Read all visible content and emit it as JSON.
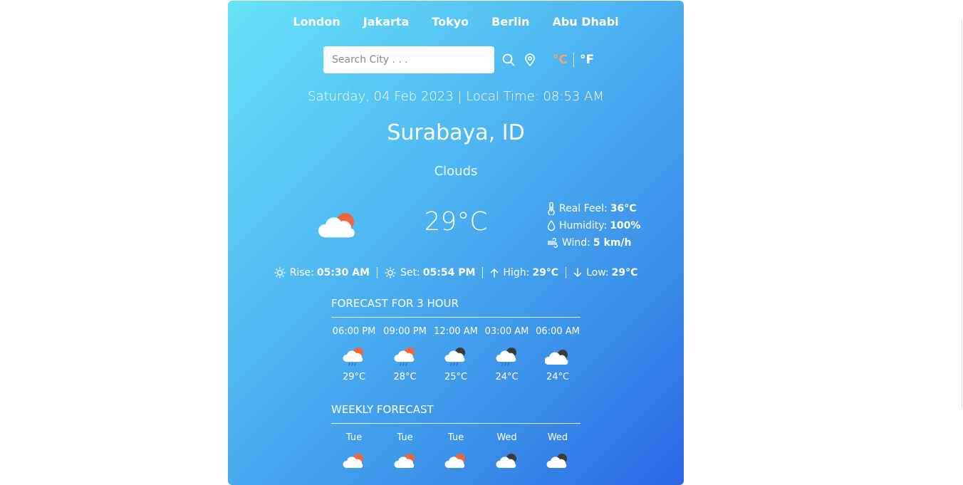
{
  "cities": [
    "London",
    "Jakarta",
    "Tokyo",
    "Berlin",
    "Abu Dhabi"
  ],
  "search": {
    "placeholder": "Search City . . .",
    "value": ""
  },
  "units": {
    "celsius": "°C",
    "fahrenheit": "°F",
    "active": "celsius"
  },
  "datetime": "Saturday, 04 Feb 2023 | Local Time: 08:53 AM",
  "location": "Surabaya, ID",
  "condition": "Clouds",
  "current": {
    "icon": "partly-cloudy-day-icon",
    "temperature": "29°C",
    "details": {
      "real_feel_label": "Real Feel:",
      "real_feel_value": "36°C",
      "humidity_label": "Humidity:",
      "humidity_value": "100%",
      "wind_label": "Wind:",
      "wind_value": "5 km/h"
    }
  },
  "sun": {
    "rise_label": "Rise:",
    "rise_value": "05:30 AM",
    "set_label": "Set:",
    "set_value": "05:54 PM",
    "high_label": "High:",
    "high_value": "29°C",
    "low_label": "Low:",
    "low_value": "29°C"
  },
  "hourly": {
    "title": "FORECAST FOR 3 HOUR",
    "items": [
      {
        "time": "06:00 PM",
        "temp": "29°C",
        "icon": "rain-day-icon"
      },
      {
        "time": "09:00 PM",
        "temp": "28°C",
        "icon": "rain-day-icon"
      },
      {
        "time": "12:00 AM",
        "temp": "25°C",
        "icon": "rain-night-icon"
      },
      {
        "time": "03:00 AM",
        "temp": "24°C",
        "icon": "rain-night-icon"
      },
      {
        "time": "06:00 AM",
        "temp": "24°C",
        "icon": "cloudy-night-icon"
      }
    ]
  },
  "weekly": {
    "title": "WEEKLY FORECAST",
    "items": [
      {
        "day": "Tue",
        "icon": "rain-day-icon"
      },
      {
        "day": "Tue",
        "icon": "rain-day-icon"
      },
      {
        "day": "Tue",
        "icon": "rain-day-icon"
      },
      {
        "day": "Wed",
        "icon": "rain-night-icon"
      },
      {
        "day": "Wed",
        "icon": "rain-night-icon"
      }
    ]
  },
  "colors": {
    "gradient_start": "#67e3f7",
    "gradient_end": "#2b67e6",
    "active_unit": "#f6a66a",
    "sun": "#f0653c",
    "moon": "#3a3a3a"
  }
}
